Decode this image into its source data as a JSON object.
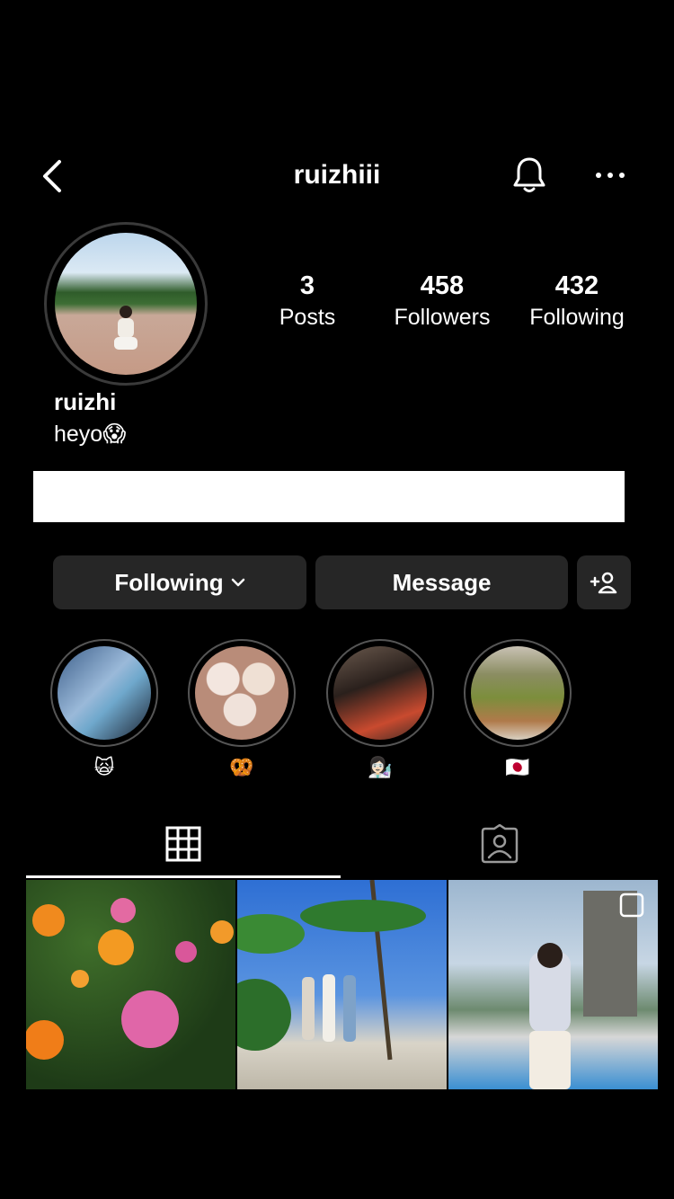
{
  "header": {
    "title": "ruizhiii"
  },
  "profile": {
    "display_name": "ruizhi",
    "bio": "heyo😱"
  },
  "stats": [
    {
      "value": "3",
      "label": "Posts"
    },
    {
      "value": "458",
      "label": "Followers"
    },
    {
      "value": "432",
      "label": "Following"
    }
  ],
  "actions": {
    "following_label": "Following",
    "message_label": "Message"
  },
  "highlights": [
    {
      "label": "🙀"
    },
    {
      "label": "🥨"
    },
    {
      "label": "👩🏻‍🔬"
    },
    {
      "label": "🇯🇵"
    }
  ],
  "tabs": [
    {
      "icon": "grid-icon",
      "active": true
    },
    {
      "icon": "tagged-icon",
      "active": false
    }
  ],
  "colors": {
    "background": "#000000",
    "button_bg": "#262626",
    "text": "#ffffff"
  }
}
